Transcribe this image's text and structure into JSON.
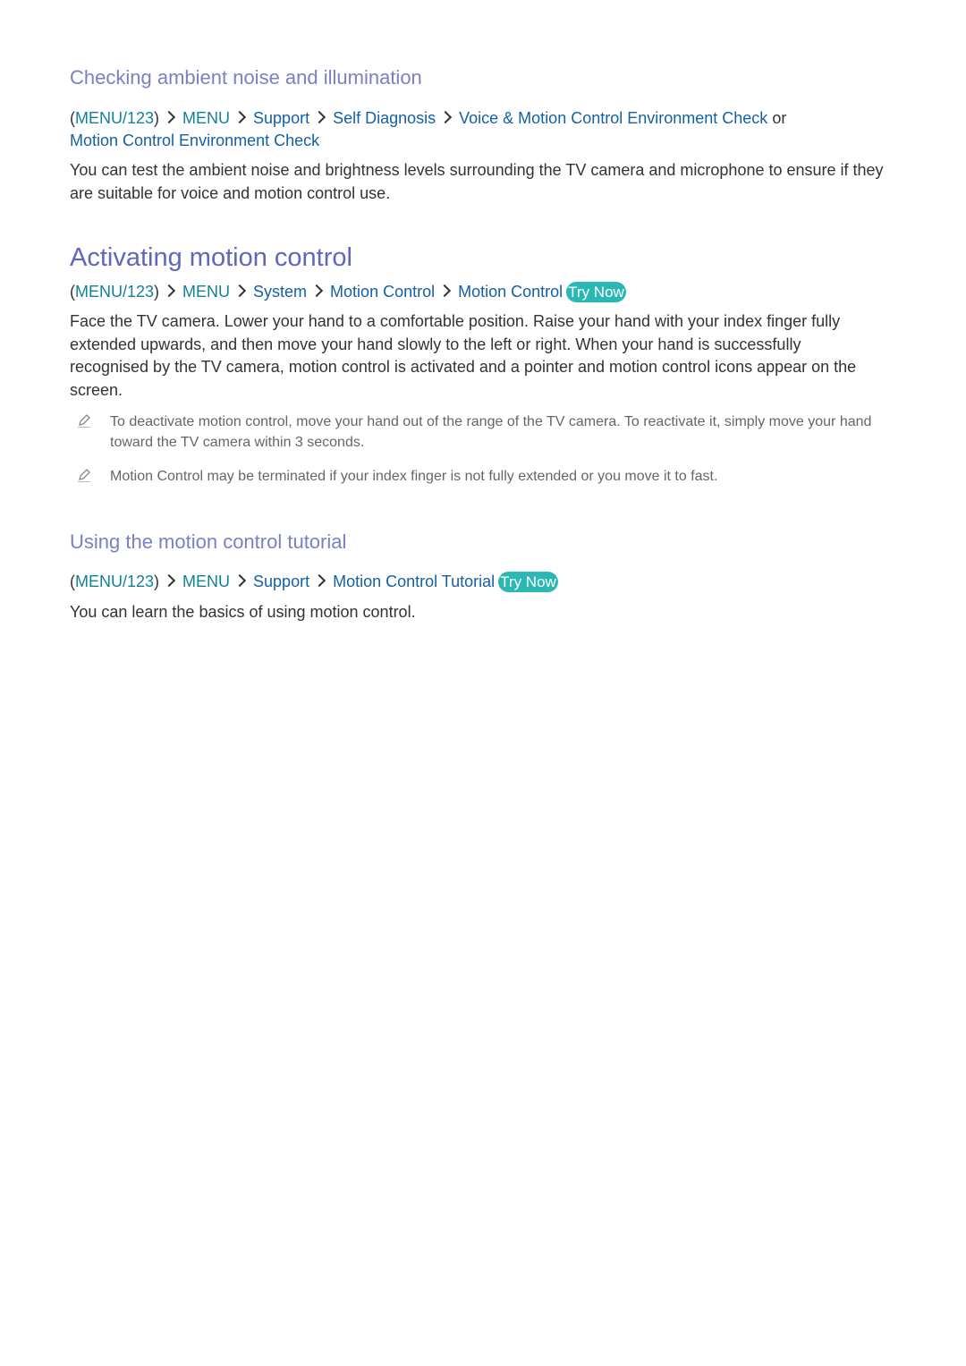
{
  "section1": {
    "heading": "Checking ambient noise and illumination",
    "path": [
      {
        "t": "(",
        "c": "plain"
      },
      {
        "t": "MENU/123",
        "c": "teal"
      },
      {
        "t": ")",
        "c": "plain"
      },
      {
        "t": "MENU",
        "c": "teal",
        "chev": true
      },
      {
        "t": "Support",
        "c": "blue",
        "chev": true
      },
      {
        "t": "Self Diagnosis",
        "c": "blue",
        "chev": true
      },
      {
        "t": "Voice & Motion Control Environment Check",
        "c": "blue",
        "chev": true
      }
    ],
    "or": "or",
    "path_line2": "Motion Control Environment Check",
    "body": "You can test the ambient noise and brightness levels surrounding the TV camera and microphone to ensure if they are suitable for voice and motion control use."
  },
  "section2": {
    "heading": "Activating motion control",
    "path": {
      "p1": "MENU/123",
      "p2": "MENU",
      "p3": "System",
      "p4": "Motion Control",
      "p5": "Motion Control"
    },
    "try_now": "Try Now",
    "body": "Face the TV camera. Lower your hand to a comfortable position. Raise your hand with your index finger fully extended upwards, and then move your hand slowly to the left or right. When your hand is successfully recognised by the TV camera, motion control is activated and a pointer and motion control icons appear on the screen.",
    "notes": [
      "To deactivate motion control, move your hand out of the range of the TV camera. To reactivate it, simply move your hand toward the TV camera within 3 seconds.",
      "Motion Control may be terminated if your index finger is not fully extended or you move it to fast."
    ]
  },
  "section3": {
    "heading": "Using the motion control tutorial",
    "path": {
      "p1": "MENU/123",
      "p2": "MENU",
      "p3": "Support",
      "p4": "Motion Control Tutorial"
    },
    "try_now": "Try Now",
    "body": "You can learn the basics of using motion control."
  }
}
